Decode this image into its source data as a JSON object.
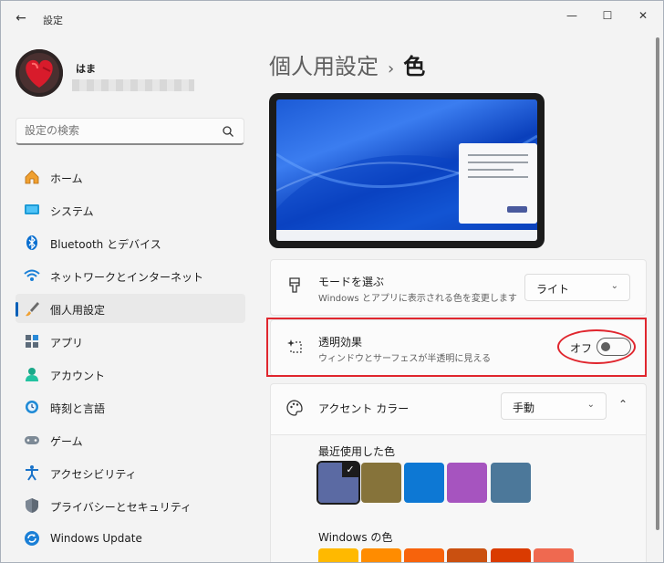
{
  "window": {
    "title": "設定",
    "back": "←",
    "minimize": "—",
    "maximize": "☐",
    "close": "✕"
  },
  "profile": {
    "name": "はま"
  },
  "search": {
    "placeholder": "設定の検索"
  },
  "sidebar": {
    "items": [
      {
        "label": "ホーム",
        "icon": "home-icon"
      },
      {
        "label": "システム",
        "icon": "system-icon"
      },
      {
        "label": "Bluetooth とデバイス",
        "icon": "bluetooth-icon"
      },
      {
        "label": "ネットワークとインターネット",
        "icon": "network-icon"
      },
      {
        "label": "個人用設定",
        "icon": "brush-icon",
        "active": true
      },
      {
        "label": "アプリ",
        "icon": "apps-icon"
      },
      {
        "label": "アカウント",
        "icon": "account-icon"
      },
      {
        "label": "時刻と言語",
        "icon": "time-language-icon"
      },
      {
        "label": "ゲーム",
        "icon": "gaming-icon"
      },
      {
        "label": "アクセシビリティ",
        "icon": "accessibility-icon"
      },
      {
        "label": "プライバシーとセキュリティ",
        "icon": "shield-icon"
      },
      {
        "label": "Windows Update",
        "icon": "update-icon"
      }
    ]
  },
  "breadcrumb": {
    "parent": "個人用設定",
    "separator": "›",
    "current": "色"
  },
  "mode": {
    "title": "モードを選ぶ",
    "description": "Windows とアプリに表示される色を変更します",
    "value": "ライト",
    "chevron": "⌄"
  },
  "transparency": {
    "title": "透明効果",
    "description": "ウィンドウとサーフェスが半透明に見える",
    "state_label": "オフ",
    "enabled": false
  },
  "accent": {
    "title": "アクセント カラー",
    "value": "手動",
    "chevron": "⌄",
    "collapse": "⌃",
    "recent_label": "最近使用した色",
    "recent_colors": [
      "#5b6aa3",
      "#86733a",
      "#0d78d4",
      "#a654bf",
      "#4c789a"
    ],
    "selected_check": "✓",
    "windows_label": "Windows の色",
    "windows_colors": [
      "#ffb900",
      "#ff8c00",
      "#f7630c",
      "#ca5010",
      "#da3b01",
      "#ef6950"
    ]
  },
  "colors": {
    "accent": "#005fb8",
    "annotation_red": "#e0262e"
  }
}
